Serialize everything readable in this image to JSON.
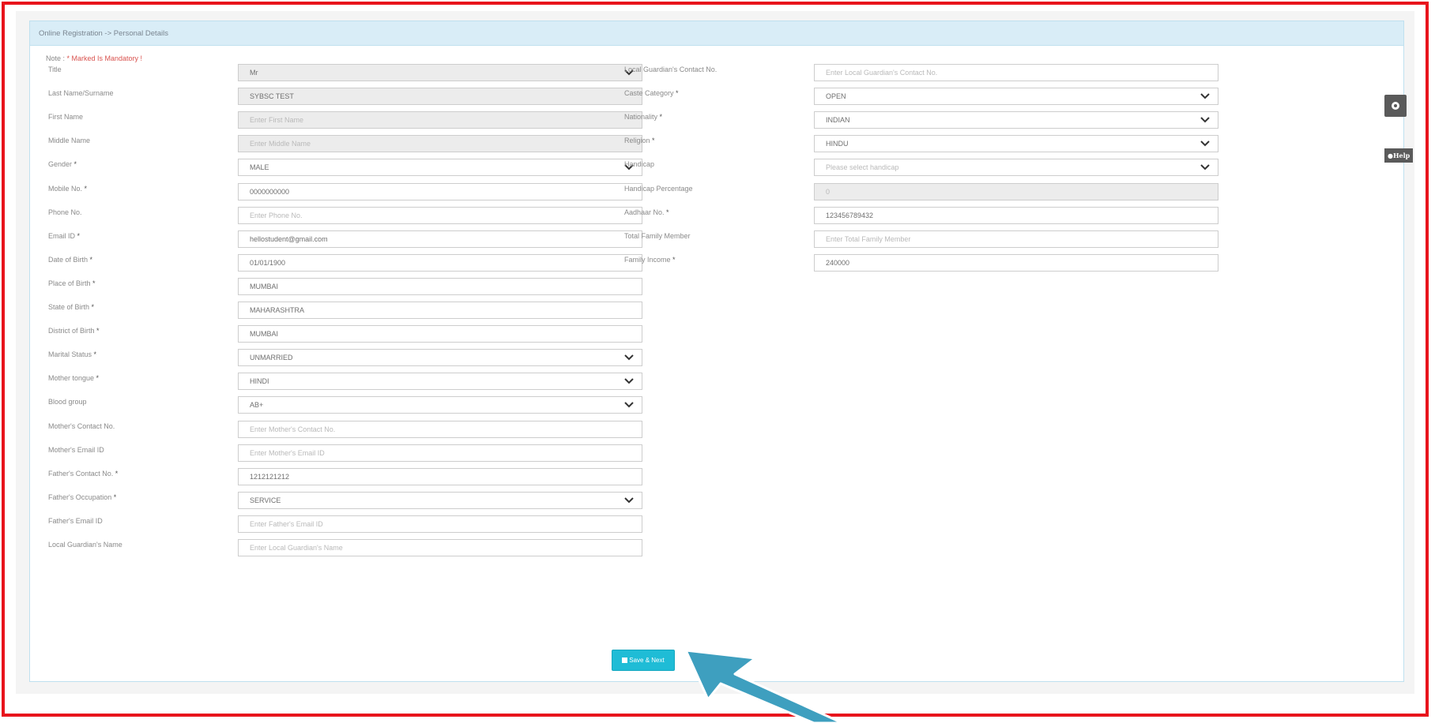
{
  "panel": {
    "heading": "Online Registration -> Personal Details",
    "note_prefix": "Note : ",
    "note_mandatory": "* Marked Is Mandatory !"
  },
  "left_fields": [
    {
      "label": "Title",
      "required": false,
      "value": "Mr",
      "type": "select",
      "disabled": true,
      "placeholder": false
    },
    {
      "label": "Last Name/Surname",
      "required": false,
      "value": "SYBSC TEST",
      "type": "text",
      "disabled": true,
      "placeholder": false
    },
    {
      "label": "First Name",
      "required": false,
      "value": "Enter First Name",
      "type": "text",
      "disabled": true,
      "placeholder": true
    },
    {
      "label": "Middle Name",
      "required": false,
      "value": "Enter Middle Name",
      "type": "text",
      "disabled": true,
      "placeholder": true
    },
    {
      "label": "Gender",
      "required": true,
      "value": "MALE",
      "type": "select",
      "disabled": false,
      "placeholder": false
    },
    {
      "label": "Mobile No.",
      "required": true,
      "value": "0000000000",
      "type": "text",
      "disabled": false,
      "placeholder": false
    },
    {
      "label": "Phone No.",
      "required": false,
      "value": "Enter Phone No.",
      "type": "text",
      "disabled": false,
      "placeholder": true
    },
    {
      "label": "Email ID",
      "required": true,
      "value": "hellostudent@gmail.com",
      "type": "text",
      "disabled": false,
      "placeholder": false
    },
    {
      "label": "Date of Birth",
      "required": true,
      "value": "01/01/1900",
      "type": "text",
      "disabled": false,
      "placeholder": false
    },
    {
      "label": "Place of Birth",
      "required": true,
      "value": "MUMBAI",
      "type": "text",
      "disabled": false,
      "placeholder": false
    },
    {
      "label": "State of Birth",
      "required": true,
      "value": "MAHARASHTRA",
      "type": "text",
      "disabled": false,
      "placeholder": false
    },
    {
      "label": "District of Birth",
      "required": true,
      "value": "MUMBAI",
      "type": "text",
      "disabled": false,
      "placeholder": false
    },
    {
      "label": "Marital Status",
      "required": true,
      "value": "UNMARRIED",
      "type": "select",
      "disabled": false,
      "placeholder": false
    },
    {
      "label": "Mother tongue",
      "required": true,
      "value": "HINDI",
      "type": "select",
      "disabled": false,
      "placeholder": false
    },
    {
      "label": "Blood group",
      "required": false,
      "value": "AB+",
      "type": "select",
      "disabled": false,
      "placeholder": false
    },
    {
      "label": "Mother's Contact No.",
      "required": false,
      "value": "Enter Mother's Contact No.",
      "type": "text",
      "disabled": false,
      "placeholder": true
    },
    {
      "label": "Mother's Email ID",
      "required": false,
      "value": "Enter Mother's Email ID",
      "type": "text",
      "disabled": false,
      "placeholder": true
    },
    {
      "label": "Father's Contact No.",
      "required": true,
      "value": "1212121212",
      "type": "text",
      "disabled": false,
      "placeholder": false
    },
    {
      "label": "Father's Occupation",
      "required": true,
      "value": "SERVICE",
      "type": "select",
      "disabled": false,
      "placeholder": false
    },
    {
      "label": "Father's Email ID",
      "required": false,
      "value": "Enter Father's Email ID",
      "type": "text",
      "disabled": false,
      "placeholder": true
    },
    {
      "label": "Local Guardian's Name",
      "required": false,
      "value": "Enter Local Guardian's Name",
      "type": "text",
      "disabled": false,
      "placeholder": true
    }
  ],
  "right_fields": [
    {
      "label": "Local Guardian's Contact No.",
      "required": false,
      "value": "Enter Local Guardian's Contact No.",
      "type": "text",
      "disabled": false,
      "placeholder": true
    },
    {
      "label": "Caste Category",
      "required": true,
      "value": "OPEN",
      "type": "select",
      "disabled": false,
      "placeholder": false
    },
    {
      "label": "Nationality",
      "required": true,
      "value": "INDIAN",
      "type": "select",
      "disabled": false,
      "placeholder": false
    },
    {
      "label": "Religion",
      "required": true,
      "value": "HINDU",
      "type": "select",
      "disabled": false,
      "placeholder": false
    },
    {
      "label": "Handicap",
      "required": false,
      "value": "Please select handicap",
      "type": "select",
      "disabled": false,
      "placeholder": true
    },
    {
      "label": "Handicap Percentage",
      "required": false,
      "value": "0",
      "type": "text",
      "disabled": true,
      "placeholder": true
    },
    {
      "label": "Aadhaar No.",
      "required": true,
      "value": "123456789432",
      "type": "text",
      "disabled": false,
      "placeholder": false
    },
    {
      "label": "Total Family Member",
      "required": false,
      "value": "Enter Total Family Member",
      "type": "text",
      "disabled": false,
      "placeholder": true
    },
    {
      "label": "Family Income",
      "required": true,
      "value": "240000",
      "type": "text",
      "disabled": false,
      "placeholder": false
    }
  ],
  "save_button": {
    "label": "Save & Next"
  },
  "side_help": {
    "label": "Help"
  },
  "colors": {
    "border": "#e8141c",
    "accent": "#1fbcd6",
    "arrow": "#3e9fbf",
    "heading_bg": "#d9edf7"
  }
}
